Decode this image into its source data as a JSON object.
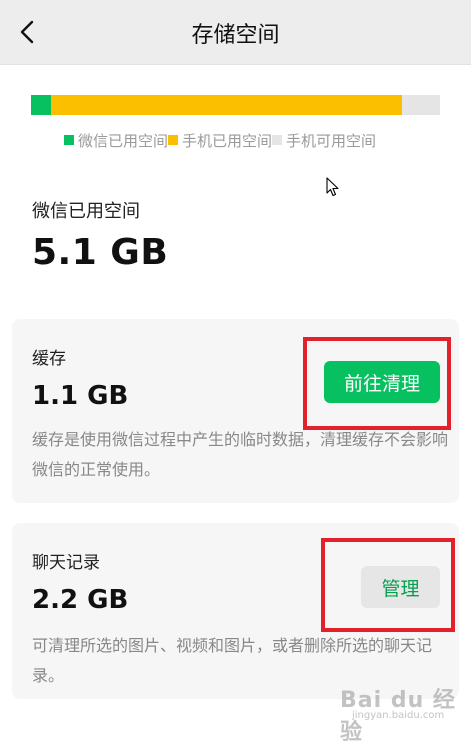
{
  "header": {
    "title": "存储空间"
  },
  "storage_bar": {
    "segments": [
      {
        "name": "微信已用空间",
        "fraction": 0.048,
        "color": "#07c160"
      },
      {
        "name": "手机已用空间",
        "fraction": 0.858,
        "color": "#fbbf00"
      },
      {
        "name": "手机可用空间",
        "fraction": 0.094,
        "color": "#e5e5e5"
      }
    ]
  },
  "legend": {
    "items": [
      {
        "label": "微信已用空间",
        "color": "#07c160"
      },
      {
        "label": "手机已用空间",
        "color": "#fbbf00"
      },
      {
        "label": "手机可用空间",
        "color": "#e5e5e5"
      }
    ]
  },
  "wechat_usage": {
    "label": "微信已用空间",
    "size": "5.1 GB"
  },
  "cache": {
    "name": "缓存",
    "size": "1.1 GB",
    "description": "缓存是使用微信过程中产生的临时数据，清理缓存不会影响微信的正常使用。",
    "button": "前往清理"
  },
  "chat_history": {
    "name": "聊天记录",
    "size": "2.2 GB",
    "description": "可清理所选的图片、视频和图片，或者删除所选的聊天记录。",
    "button": "管理"
  },
  "watermark": {
    "text": "Bai du 经验",
    "sub": "jingyan.baidu.com"
  },
  "colors": {
    "accent": "#07c160",
    "highlight": "#e2212d"
  }
}
